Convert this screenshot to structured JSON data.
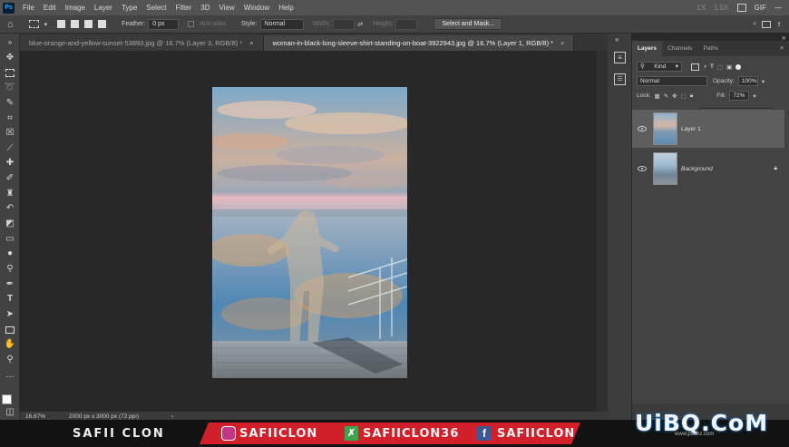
{
  "menubar": {
    "logo": "Ps",
    "items": [
      "File",
      "Edit",
      "Image",
      "Layer",
      "Type",
      "Select",
      "Filter",
      "3D",
      "View",
      "Window",
      "Help"
    ],
    "right": {
      "zoom1": "1X",
      "zoom2": "1.5X",
      "gif": "GIF"
    }
  },
  "options": {
    "feather_label": "Feather:",
    "feather_value": "0 px",
    "antialias": "Anti-alias",
    "style_label": "Style:",
    "style_value": "Normal",
    "width_label": "Width:",
    "height_label": "Height:",
    "select_mask": "Select and Mask..."
  },
  "tabs": [
    {
      "label": "blue-orange-and-yellow-sunset-53893.jpg @ 16.7% (Layer 3, RGB/8) *",
      "close": "×"
    },
    {
      "label": "woman-in-black-long-sleeve-shirt-standing-on-boat-3922943.jpg @ 16.7% (Layer 1, RGB/8) *",
      "close": "×"
    }
  ],
  "status": {
    "zoom": "16.67%",
    "doc_info": "2000 px x 3000 px (72 ppi)",
    "arrow": "›"
  },
  "layers_panel": {
    "tabs": [
      "Layers",
      "Channels",
      "Paths"
    ],
    "kind": "Kind",
    "blend_mode": "Normal",
    "opacity_label": "Opacity:",
    "opacity_value": "100%",
    "lock_label": "Lock:",
    "fill_label": "Fill:",
    "fill_value": "72%",
    "fill_fraction": 0.72,
    "layers": [
      {
        "name": "Layer 1",
        "visible": true,
        "selected": true
      },
      {
        "name": "Background",
        "visible": true,
        "locked": true
      }
    ]
  },
  "banner": {
    "name": "SAFII CLON",
    "instagram": "SAFIICLON",
    "other": "SAFIICLON36",
    "facebook": "SAFIICLON"
  },
  "watermark": {
    "text": "UiBQ.CoM",
    "url": "www.psahz.com"
  },
  "colors": {
    "accent_red": "#d1202a",
    "ui_dark": "#282828",
    "panel": "#434343"
  }
}
